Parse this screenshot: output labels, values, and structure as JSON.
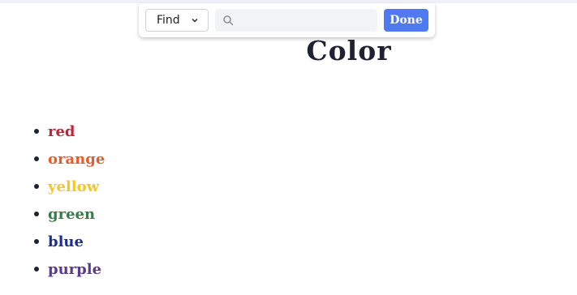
{
  "find_bar": {
    "mode_label": "Find",
    "mode_icon": "chevron-down-icon",
    "search_icon": "search-icon",
    "search_value": "",
    "done_label": "Done",
    "accent_color": "#4f79f0"
  },
  "page": {
    "title": "Color"
  },
  "colors": [
    {
      "label": "red",
      "color": "#c0243a"
    },
    {
      "label": "orange",
      "color": "#ea5b2c"
    },
    {
      "label": "yellow",
      "color": "#f2c824"
    },
    {
      "label": "green",
      "color": "#3a7a4b"
    },
    {
      "label": "blue",
      "color": "#1d2f8c"
    },
    {
      "label": "purple",
      "color": "#5a3a8c"
    }
  ]
}
